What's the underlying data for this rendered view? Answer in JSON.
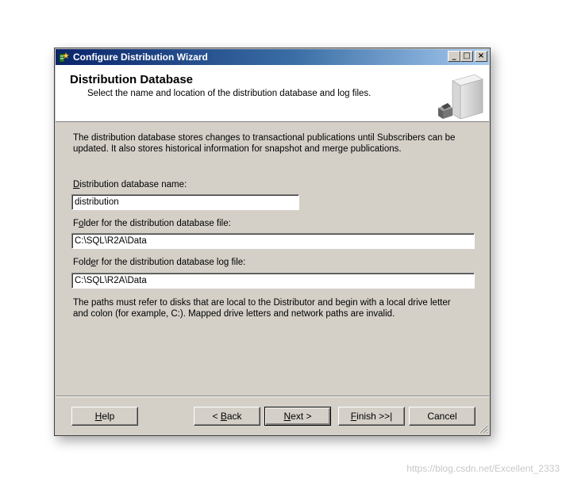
{
  "window": {
    "title": "Configure Distribution Wizard",
    "controls": {
      "minimize": "_",
      "maximize": "□",
      "close": "×"
    }
  },
  "header": {
    "title": "Distribution Database",
    "subtitle": "Select the name and location of the distribution database and log files."
  },
  "intro_text": {
    "line1": "The distribution database stores changes to transactional publications until Subscribers can be",
    "line2": "updated. It also stores historical information for snapshot and merge publications."
  },
  "fields": {
    "db_name": {
      "label_access": "D",
      "label_rest": "istribution database name:",
      "value": "distribution"
    },
    "data_folder": {
      "label_pre": "F",
      "label_access": "o",
      "label_rest": "lder for the distribution database file:",
      "value": "C:\\SQL\\R2A\\Data"
    },
    "log_folder": {
      "label_pre": "Fold",
      "label_access": "e",
      "label_rest": "r for the distribution database log file:",
      "value": "C:\\SQL\\R2A\\Data"
    }
  },
  "note_text": {
    "line1": "The paths must refer to disks that are local to the Distributor and begin with a local drive letter",
    "line2": "and colon (for example, C:). Mapped drive letters and network paths are invalid."
  },
  "buttons": {
    "help": {
      "access": "H",
      "rest": "elp"
    },
    "back": {
      "pre": "< ",
      "access": "B",
      "rest": "ack"
    },
    "next": {
      "access": "N",
      "rest": "ext >"
    },
    "finish": {
      "access": "F",
      "rest": "inish >>|"
    },
    "cancel": "Cancel"
  },
  "watermark": "https://blog.csdn.net/Excellent_2333",
  "icons": {
    "app": "wizard-app-icon",
    "header": "server-database-icon",
    "grip": "resize-grip-icon"
  },
  "colors": {
    "titlebar_start": "#0a246a",
    "titlebar_end": "#a6caf0",
    "dialog_face": "#d4d0c8"
  }
}
